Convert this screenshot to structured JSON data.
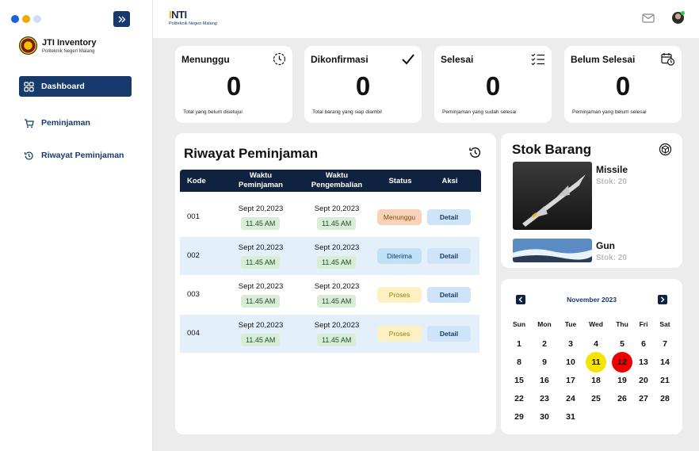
{
  "sidebar": {
    "window_dots": [
      "#1565d8",
      "#f2a900",
      "#cfe0f3"
    ],
    "brand_title": "JTI Inventory",
    "brand_subtitle": "Politeknik Negeri Malang",
    "items": [
      {
        "label": "Dashboard",
        "icon": "grid-icon",
        "active": true
      },
      {
        "label": "Peminjaman",
        "icon": "cart-icon",
        "active": false
      },
      {
        "label": "Riwayat Peminjaman",
        "icon": "history-icon",
        "active": false
      }
    ]
  },
  "topbar": {
    "logo_text": "NTI",
    "logo_subtitle": "Politeknik Negeri Malang",
    "icons": [
      "mail-icon",
      "avatar"
    ]
  },
  "stats": [
    {
      "title": "Menunggu",
      "value": "0",
      "desc": "Total yang belum disetujui",
      "icon": "clock-icon"
    },
    {
      "title": "Dikonfirmasi",
      "value": "0",
      "desc": "Total barang yang siap diambil",
      "icon": "check-icon"
    },
    {
      "title": "Selesai",
      "value": "0",
      "desc": "Peminjaman yang sudah selesai",
      "icon": "checklist-icon"
    },
    {
      "title": "Belum Selesai",
      "value": "0",
      "desc": "Peminjaman yang belum selesai",
      "icon": "calendar-clock-icon"
    }
  ],
  "riwayat": {
    "title": "Riwayat Peminjaman",
    "columns": [
      "Kode",
      "Waktu\nPeminjaman",
      "Waktu\nPengembalian",
      "Status",
      "Aksi"
    ],
    "rows": [
      {
        "kode": "001",
        "pinjam_date": "Sept 20,2023",
        "pinjam_time": "11.45 AM",
        "kembali_date": "Sept 20,2023",
        "kembali_time": "11.45 AM",
        "status": "Menunggu",
        "aksi": "Detail"
      },
      {
        "kode": "002",
        "pinjam_date": "Sept 20,2023",
        "pinjam_time": "11.45 AM",
        "kembali_date": "Sept 20,2023",
        "kembali_time": "11.45 AM",
        "status": "Diterima",
        "aksi": "Detail"
      },
      {
        "kode": "003",
        "pinjam_date": "Sept 20,2023",
        "pinjam_time": "11.45 AM",
        "kembali_date": "Sept 20,2023",
        "kembali_time": "11.45 AM",
        "status": "Proses",
        "aksi": "Detail"
      },
      {
        "kode": "004",
        "pinjam_date": "Sept 20,2023",
        "pinjam_time": "11.45 AM",
        "kembali_date": "Sept 20,2023",
        "kembali_time": "11.45 AM",
        "status": "Proses",
        "aksi": "Detail"
      }
    ],
    "status_colors": {
      "Menunggu": {
        "bg": "#f6d3b8",
        "fg": "#8a4a1c"
      },
      "Diterima": {
        "bg": "#bfe0f6",
        "fg": "#163a6b"
      },
      "Proses": {
        "bg": "#fdf1c4",
        "fg": "#a07b00"
      }
    }
  },
  "stok": {
    "title": "Stok Barang",
    "items": [
      {
        "name": "Missile",
        "stock": "Stok: 20"
      },
      {
        "name": "Gun",
        "stock": "Stok: 20"
      }
    ]
  },
  "calendar": {
    "month": "November 2023",
    "weekdays": [
      "Sun",
      "Mon",
      "Tue",
      "Wed",
      "Thu",
      "Fri",
      "Sat"
    ],
    "weeks": [
      [
        "1",
        "2",
        "3",
        "4",
        "5",
        "6",
        "7"
      ],
      [
        "8",
        "9",
        "10",
        "11",
        "12",
        "13",
        "14"
      ],
      [
        "15",
        "16",
        "17",
        "18",
        "19",
        "20",
        "21"
      ],
      [
        "22",
        "23",
        "24",
        "25",
        "26",
        "27",
        "28"
      ],
      [
        "29",
        "30",
        "31",
        "",
        "",
        "",
        ""
      ]
    ],
    "highlight_yellow": "11",
    "highlight_red": "12"
  }
}
